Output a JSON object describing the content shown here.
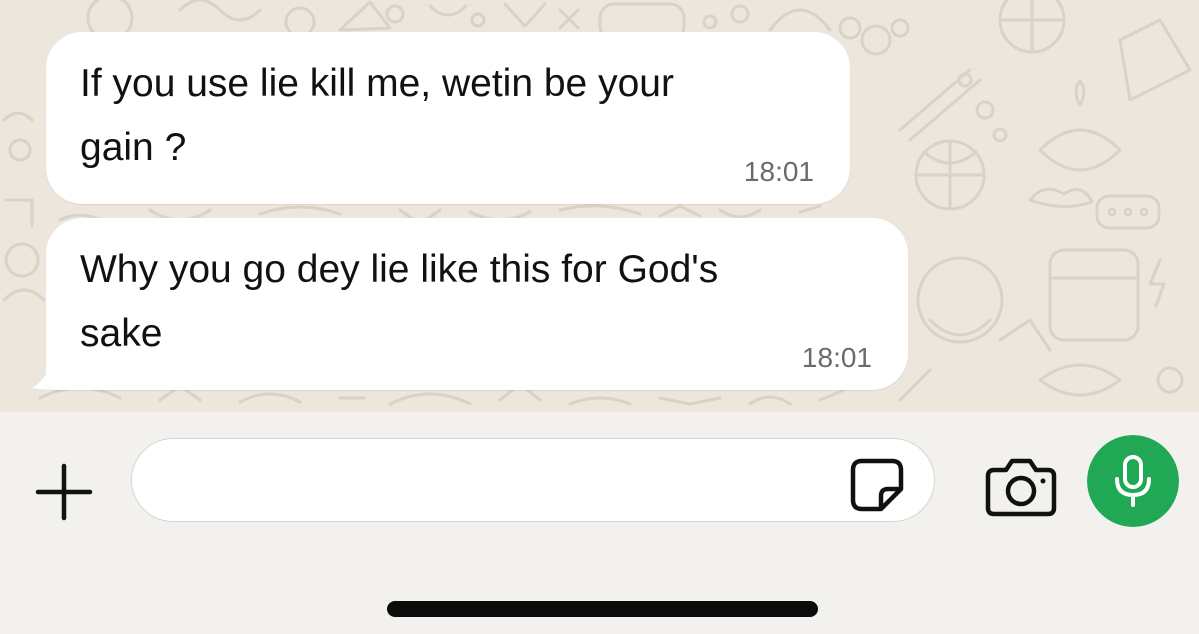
{
  "colors": {
    "chat_background": "#ece6dc",
    "bubble_incoming": "#ffffff",
    "composer_background": "#f3f1ee",
    "mic_button": "#21a855",
    "timestamp_text": "#6b6b6b",
    "home_indicator": "#0b0b0b"
  },
  "messages": [
    {
      "text": "If you use lie kill me, wetin be your\ngain ?",
      "time": "18:01",
      "direction": "incoming"
    },
    {
      "text": "Why you go dey lie like this for God's\nsake",
      "time": "18:01",
      "direction": "incoming"
    }
  ],
  "composer": {
    "input_value": "",
    "input_placeholder": "",
    "icons": {
      "attach": "plus-icon",
      "sticker": "sticker-icon",
      "camera": "camera-icon",
      "voice": "microphone-icon"
    }
  }
}
